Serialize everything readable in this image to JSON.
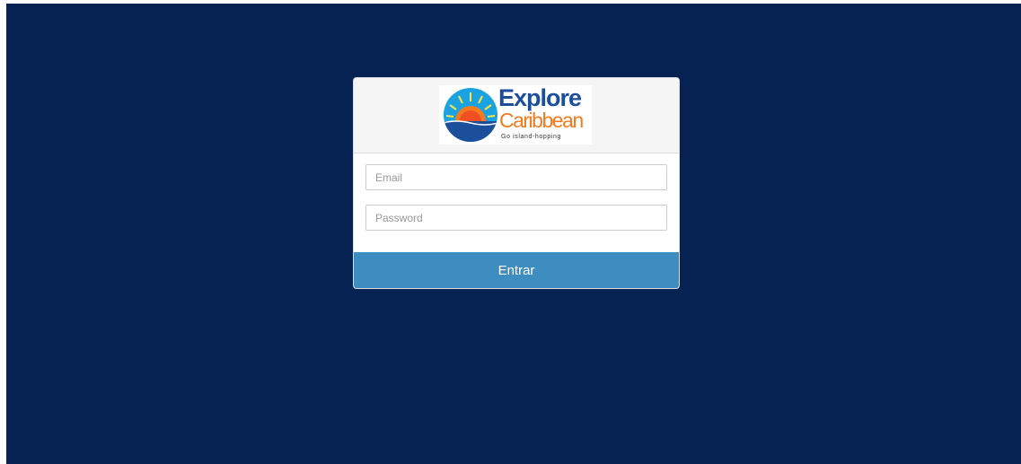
{
  "logo": {
    "title": "Explore",
    "subtitle": "Caribbean",
    "tagline": "Go island-hopping",
    "colors": {
      "blue": "#1b4f9c",
      "orange": "#f47b20",
      "sky": "#1aa3e0",
      "sun": "#f9b233"
    }
  },
  "form": {
    "email_placeholder": "Email",
    "password_placeholder": "Password",
    "submit_label": "Entrar"
  },
  "colors": {
    "background": "#062252",
    "button": "#3e8dc0",
    "header": "#f5f5f5"
  }
}
